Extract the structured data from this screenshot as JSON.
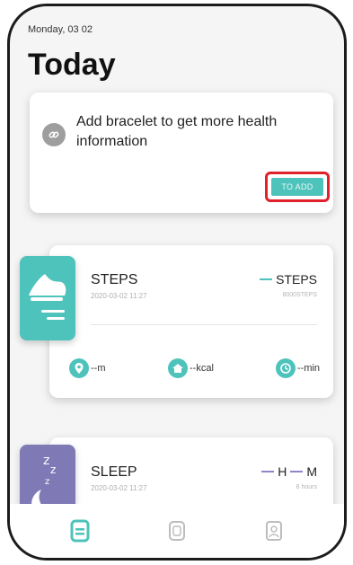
{
  "header": {
    "date": "Monday, 03 02",
    "title": "Today"
  },
  "banner": {
    "message": "Add bracelet to get more health information",
    "button_label": "TO ADD"
  },
  "steps": {
    "label": "STEPS",
    "timestamp": "2020-03-02 11:27",
    "value_text": "STEPS",
    "goal_text": "8000STEPS",
    "metrics": {
      "distance": "--m",
      "calories": "--kcal",
      "duration": "--min"
    }
  },
  "sleep": {
    "label": "SLEEP",
    "timestamp": "2020-03-02 11:27",
    "value_text": "H",
    "value_unit": "M",
    "goal_text": "8 hours"
  },
  "icons": [
    "link-icon",
    "shoe-icon",
    "location-icon",
    "home-icon",
    "clock-icon",
    "moon-icon",
    "dashboard-icon",
    "device-icon",
    "profile-icon"
  ],
  "colors": {
    "accent": "#4ec3bb",
    "sleep": "#7f7ab5",
    "highlight": "#e0202a"
  }
}
